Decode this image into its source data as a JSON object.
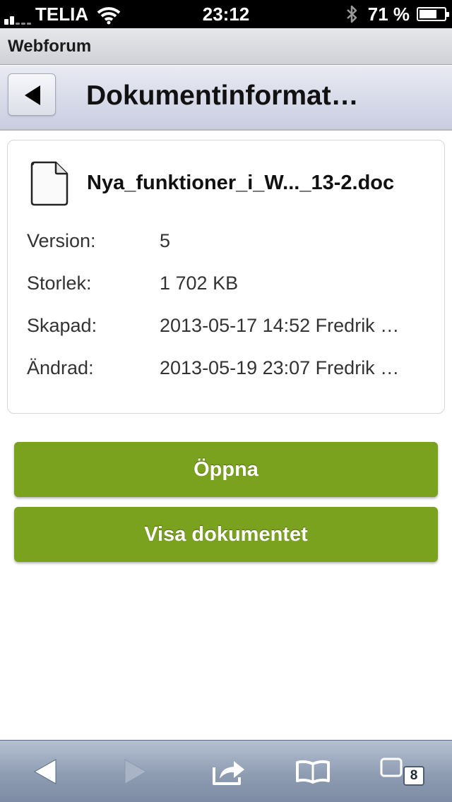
{
  "status_bar": {
    "carrier": "TELIA",
    "time": "23:12",
    "battery_text": "71 %",
    "battery_level": 0.71
  },
  "browser": {
    "title": "Webforum"
  },
  "header": {
    "title": "Dokumentinformat…"
  },
  "document": {
    "file_name": "Nya_funktioner_i_W..._13-2.doc",
    "properties": [
      {
        "label": "Version:",
        "value": "5"
      },
      {
        "label": "Storlek:",
        "value": "1 702 KB"
      },
      {
        "label": "Skapad:",
        "value": "2013-05-17 14:52 Fredrik …"
      },
      {
        "label": "Ändrad:",
        "value": "2013-05-19 23:07 Fredrik …"
      }
    ]
  },
  "actions": {
    "open_label": "Öppna",
    "view_label": "Visa dokumentet"
  },
  "toolbar": {
    "tab_count": "8"
  },
  "colors": {
    "action_green": "#7aa21e",
    "header_bg": "#d6d9e8",
    "toolbar_blue": "#8f9db3"
  }
}
